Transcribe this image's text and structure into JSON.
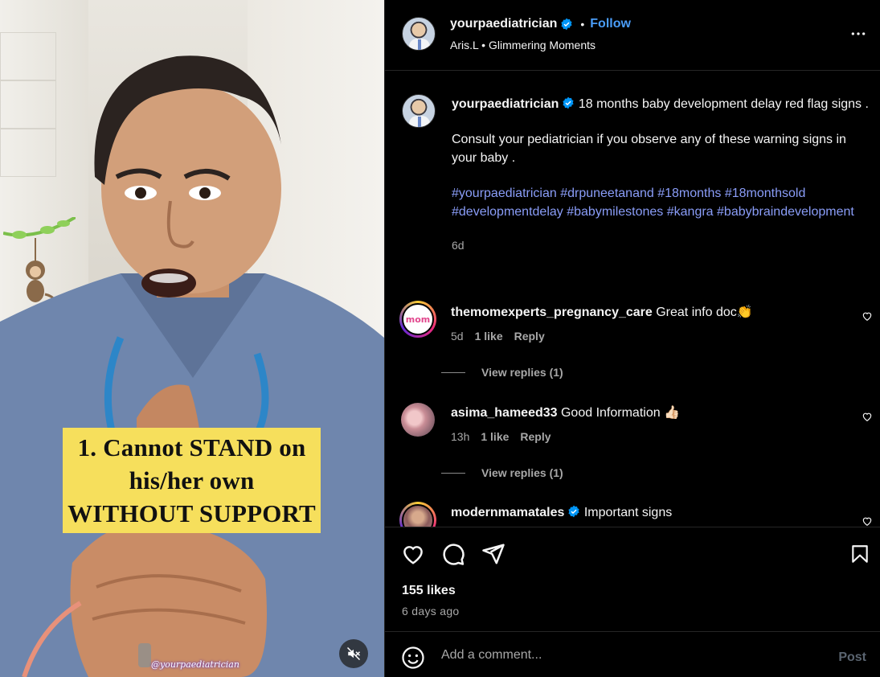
{
  "video": {
    "overlay_lines": [
      "1. Cannot STAND on",
      "his/her own",
      "WITHOUT SUPPORT"
    ],
    "watermark": "@yourpaediatrician",
    "mute_icon": "speaker-muted-icon"
  },
  "header": {
    "username": "yourpaediatrician",
    "follow_label": "Follow",
    "separator": "•",
    "audio_artist": "Aris.L",
    "audio_track": "Glimmering Moments"
  },
  "caption": {
    "username": "yourpaediatrician",
    "line1": "18 months baby development delay red flag signs .",
    "line2": "Consult your pediatrician if you observe any of these warning signs in your baby .",
    "hashtags": [
      "#yourpaediatrician",
      "#drpuneetanand",
      "#18months",
      "#18monthsold",
      "#developmentdelay",
      "#babymilestones",
      "#kangra",
      "#babybraindevelopment"
    ],
    "time": "6d"
  },
  "comments": [
    {
      "username": "themomexperts_pregnancy_care",
      "text": "Great info doc👏",
      "time": "5d",
      "likes": "1 like",
      "reply": "Reply",
      "replies": "View replies (1)",
      "avatar_text": "mom"
    },
    {
      "username": "asima_hameed33",
      "text": "Good Information 👍🏻",
      "time": "13h",
      "likes": "1 like",
      "reply": "Reply",
      "replies": "View replies (1)"
    },
    {
      "username": "modernmamatales",
      "text": "Important signs"
    }
  ],
  "stats": {
    "likes": "155 likes",
    "ago": "6 days ago"
  },
  "composer": {
    "placeholder": "Add a comment...",
    "post_label": "Post"
  },
  "colors": {
    "accent": "#4a9df8",
    "hashtag": "#8a9df8",
    "overlay_card": "#f6df5c",
    "background": "#000000"
  }
}
